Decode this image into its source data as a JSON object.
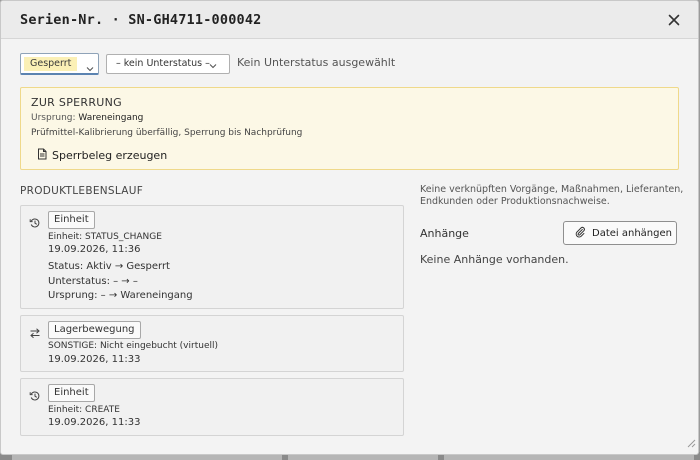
{
  "dialog": {
    "title": "Serien-Nr. · SN-GH4711-000042",
    "icons": {
      "close": "close-icon",
      "resize": "resize-grip-icon"
    }
  },
  "status": {
    "selected": "Gesperrt",
    "substatus": "– kein Unterstatus –",
    "substatus_hint": "Kein Unterstatus ausgewählt",
    "colors": {
      "locked_chip": "#fbf0b6",
      "focus_border": "#5b83b1"
    }
  },
  "lock_box": {
    "title": "ZUR SPERRUNG",
    "origin_label": "Ursprung:",
    "origin_value": "Wareneingang",
    "reason": "Prüfmittel-Kalibrierung überfällig, Sperrung bis Nachprüfung",
    "action_label": "Sperrbeleg erzeugen",
    "colors": {
      "background": "#fcf8e6",
      "border": "#efd98a"
    }
  },
  "lifecycle": {
    "title": "PRODUKTLEBENSLAUF",
    "entries": [
      {
        "icon": "history-icon",
        "tag": "Einheit",
        "event": "Einheit: STATUS_CHANGE",
        "timestamp": "19.09.2026, 11:36",
        "details": [
          "Status: Aktiv → Gesperrt",
          "Unterstatus: – → –",
          "Ursprung: – → Wareneingang"
        ]
      },
      {
        "icon": "transfer-icon",
        "tag": "Lagerbewegung",
        "event": "SONSTIGE: Nicht eingebucht (virtuell)",
        "timestamp": "19.09.2026, 11:33"
      },
      {
        "icon": "history-icon",
        "tag": "Einheit",
        "event": "Einheit: CREATE",
        "timestamp": "19.09.2026, 11:33"
      }
    ]
  },
  "side": {
    "info": "Keine verknüpften Vorgänge, Maßnahmen, Lieferanten, Endkunden oder Produktionsnachweise.",
    "attachments_label": "Anhänge",
    "attach_button": "Datei anhängen",
    "no_attachments": "Keine Anhänge vorhanden."
  }
}
